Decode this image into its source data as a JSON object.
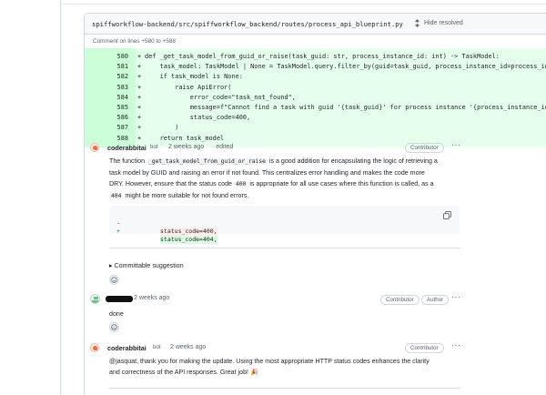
{
  "file": {
    "path": "spiffworkflow-backend/src/spiffworkflow_backend/routes/process_api_blueprint.py",
    "hide_resolved": "Hide resolved",
    "comment_on": "Comment on lines +580 to +588"
  },
  "diff": {
    "lines": [
      {
        "num": "580",
        "sign": "+",
        "code": "def _get_task_model_from_guid_or_raise(task_guid: str, process_instance_id: int) -> TaskModel:"
      },
      {
        "num": "581",
        "sign": "+",
        "code": "    task_model: TaskModel | None = TaskModel.query.filter_by(guid=task_guid, process_instance_id=process_instance_id).first()"
      },
      {
        "num": "582",
        "sign": "+",
        "code": "    if task_model is None:"
      },
      {
        "num": "583",
        "sign": "+",
        "code": "        raise ApiError("
      },
      {
        "num": "584",
        "sign": "+",
        "code": "            error_code=\"task_not_found\","
      },
      {
        "num": "585",
        "sign": "+",
        "code": "            message=f\"Cannot find a task with guid '{task_guid}' for process instance '{process_instance_id}'\","
      },
      {
        "num": "586",
        "sign": "+",
        "code": "            status_code=400,"
      },
      {
        "num": "587",
        "sign": "+",
        "code": "        )"
      },
      {
        "num": "588",
        "sign": "+",
        "code": "    return task_model"
      }
    ]
  },
  "comments": [
    {
      "author": "coderabbitai",
      "bot_label": "bot",
      "time": "2 weeks ago",
      "edited": "· edited",
      "badge": "Contributor",
      "body": {
        "p1_a": "The function ",
        "p1_code": "_get_task_model_from_guid_or_raise",
        "p1_b": " is a good addition for encapsulating the logic of retrieving a",
        "p2": "task model by GUID and raising an error if not found. This centralizes error handling and makes the code more",
        "p3_a": "DRY. However, ensure that the status code ",
        "p3_code": "400",
        "p3_b": " is appropriate for all use cases where this function is called, as a",
        "p4_code": "404",
        "p4_b": " might be more suitable for not found errors."
      },
      "suggestion": {
        "del_sign": "-",
        "del_code": "status_code=400,",
        "add_sign": "+",
        "add_code": "status_code=404,"
      },
      "committable": "Committable suggestion"
    },
    {
      "time": "2 weeks ago",
      "badges": [
        "Contributor",
        "Author"
      ],
      "body": "done"
    },
    {
      "author": "coderabbitai",
      "bot_label": "bot",
      "time": "2 weeks ago",
      "badge": "Contributor",
      "body_l1": "@jasquat, thank you for making the update. Using the most appropriate HTTP status codes enhances the clarity",
      "body_l2": "and correctness of the API responses. Great job! 🎉"
    }
  ],
  "icons": {
    "hide_resolved": "unfold-icon",
    "copy": "copy-icon",
    "react": "smiley-icon",
    "kebab": "kebab-horizontal-icon"
  },
  "colors": {
    "diff_add_bg": "#e6ffec",
    "diff_add_gutter": "#ccffd8",
    "suggestion_del_bg": "#ffebe9",
    "suggestion_add_bg": "#dafbe1",
    "bot_avatar": "#f26a3d"
  }
}
